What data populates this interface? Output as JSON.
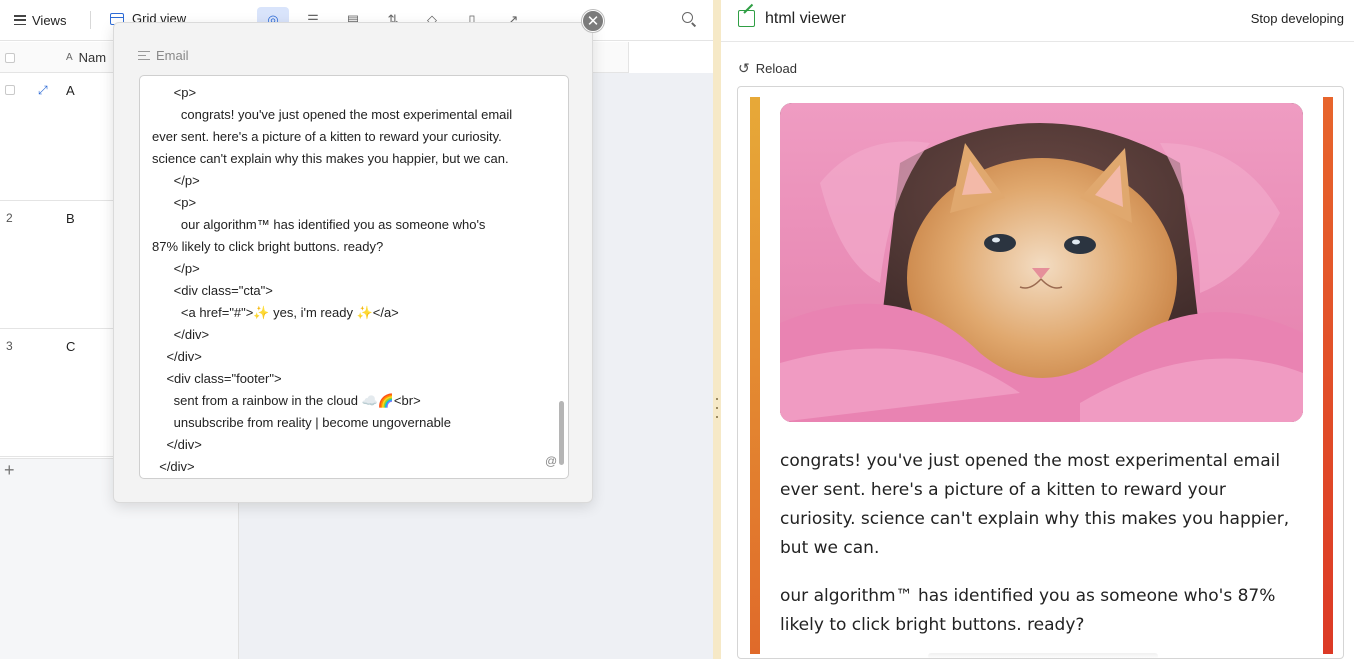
{
  "toolbar": {
    "views_label": "Views",
    "grid_view_label": "Grid view"
  },
  "grid": {
    "column_name": "Nam",
    "rows": [
      {
        "num": "",
        "value": "A"
      },
      {
        "num": "2",
        "value": "B"
      },
      {
        "num": "3",
        "value": "C"
      }
    ]
  },
  "popup": {
    "field_label": "Email",
    "code_lines": [
      "      <p>",
      "        congrats! you've just opened the most experimental email",
      "ever sent. here's a picture of a kitten to reward your curiosity.",
      "science can't explain why this makes you happier, but we can.",
      "      </p>",
      "      <p>",
      "        our algorithm™ has identified you as someone who's",
      "87% likely to click bright buttons. ready?",
      "      </p>",
      "      <div class=\"cta\">",
      "        <a href=\"#\">✨ yes, i'm ready ✨</a>",
      "      </div>",
      "    </div>",
      "    <div class=\"footer\">",
      "      sent from a rainbow in the cloud ☁️🌈<br>",
      "      unsubscribe from reality | become ungovernable",
      "    </div>",
      "  </div>"
    ],
    "close_glyph": "✕",
    "at_glyph": "@"
  },
  "viewer": {
    "title": "html viewer",
    "stop_label": "Stop developing",
    "reload_label": "Reload",
    "reload_glyph": "↺",
    "paragraphs": [
      "congrats! you've just opened the most experimental email ever sent. here's a picture of a kitten to reward your curiosity. science can't explain why this makes you happier, but we can.",
      "our algorithm™ has identified you as someone who's 87% likely to click bright buttons. ready?"
    ]
  },
  "colors": {
    "accent": "#2d6bd6",
    "splitter": "#f6e9c7",
    "bar_left_top": "#e7a938",
    "bar_right": "#dc3a26",
    "towel_pink": "#e98ab4"
  }
}
